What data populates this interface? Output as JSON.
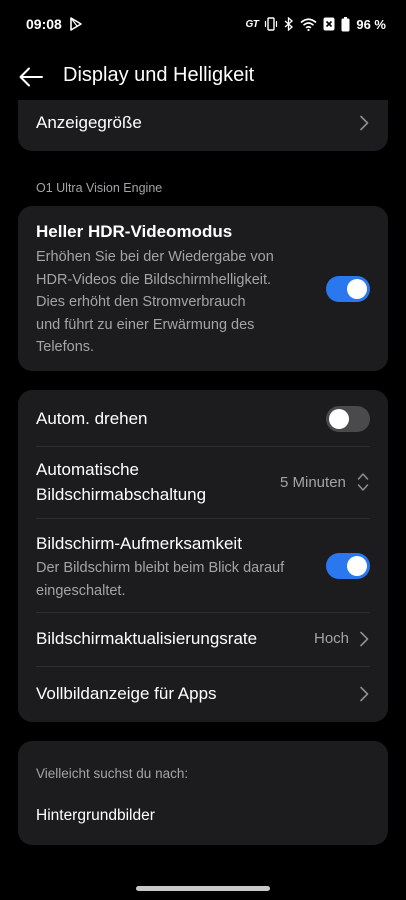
{
  "status_bar": {
    "time": "09:08",
    "battery_percent": "96 %",
    "network_label": "GT"
  },
  "header": {
    "title": "Display und Helligkeit"
  },
  "display_size_row": {
    "label": "Anzeigegröße"
  },
  "engine_section": {
    "label": "O1 Ultra Vision Engine"
  },
  "hdr_card": {
    "label": "Heller HDR-Videomodus",
    "description_lines": [
      "Erhöhen Sie bei der Wiedergabe von",
      "HDR-Videos die Bildschirmhelligkeit.",
      "Dies erhöht den Stromverbrauch",
      "und führt zu einer Erwärmung des",
      "Telefons."
    ],
    "toggle_on": true
  },
  "settings_card": {
    "auto_rotate": {
      "label": "Autom. drehen",
      "toggle_on": false
    },
    "screen_timeout": {
      "label_lines": [
        "Automatische",
        "Bildschirmabschaltung"
      ],
      "value": "5 Minuten"
    },
    "screen_attention": {
      "label": "Bildschirm-Aufmerksamkeit",
      "description_lines": [
        "Der Bildschirm bleibt beim Blick darauf",
        "eingeschaltet."
      ],
      "toggle_on": true
    },
    "refresh_rate": {
      "label": "Bildschirmaktualisierungsrate",
      "value": "Hoch"
    },
    "fullscreen_apps": {
      "label": "Vollbildanzeige für Apps"
    }
  },
  "suggestions_card": {
    "heading": "Vielleicht suchst du nach:",
    "item": "Hintergrundbilder"
  },
  "colors": {
    "background": "#000000",
    "card": "#1c1c1e",
    "accent": "#2a78ef",
    "secondary_text": "#a4a4a6"
  }
}
